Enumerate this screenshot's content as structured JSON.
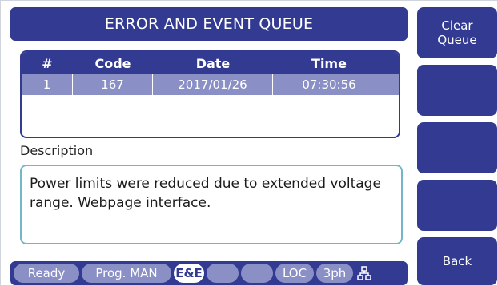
{
  "title": "ERROR AND EVENT QUEUE",
  "table": {
    "headers": [
      "#",
      "Code",
      "Date",
      "Time"
    ],
    "rows": [
      {
        "num": "1",
        "code": "167",
        "date": "2017/01/26",
        "time": "07:30:56"
      }
    ]
  },
  "description": {
    "label": "Description",
    "text": "Power limits were reduced due to extended voltage range. Webpage interface."
  },
  "side_buttons": {
    "clear_queue": "Clear Queue",
    "back": "Back"
  },
  "status_bar": {
    "ready": "Ready",
    "program": "Prog. MAN",
    "ee": "E&E",
    "loc": "LOC",
    "phase": "3ph",
    "network_icon": "network-icon"
  },
  "colors": {
    "primary": "#333a91",
    "row_highlight": "#8a8fc6",
    "desc_border": "#74b6c9"
  }
}
